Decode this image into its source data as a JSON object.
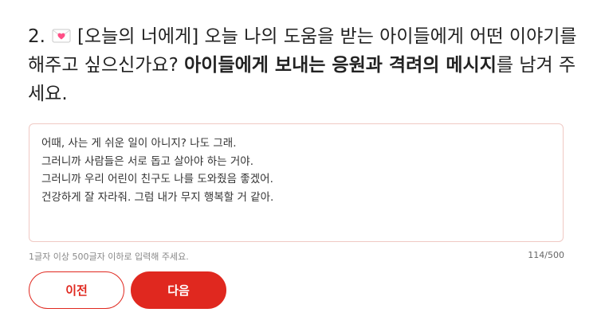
{
  "question": {
    "number": "2.",
    "icon": "love-letter-icon",
    "text_regular": "[오늘의 너에게] 오늘 나의 도움을 받는 아이들에게 어떤 이야기를 해주고 싶으신가요? ",
    "text_bold": "아이들에게 보내는 응원과 격려의 메시지",
    "text_end": "를 남겨 주세요."
  },
  "answer": {
    "value": "어때, 사는 게 쉬운 일이 아니지? 나도 그래.\n그러니까 사람들은 서로 돕고 살아야 하는 거야.\n그러니까 우리 어린이 친구도 나를 도와줬음 좋겠어.\n건강하게 잘 자라줘. 그럼 내가 무지 행복할 거 같아."
  },
  "hint": "1글자 이상 500글자 이하로 입력해 주세요.",
  "counter": "114/500",
  "buttons": {
    "prev_label": "이전",
    "next_label": "다음"
  },
  "colors": {
    "accent": "#e0281f",
    "box_border": "#f0c9c4"
  }
}
